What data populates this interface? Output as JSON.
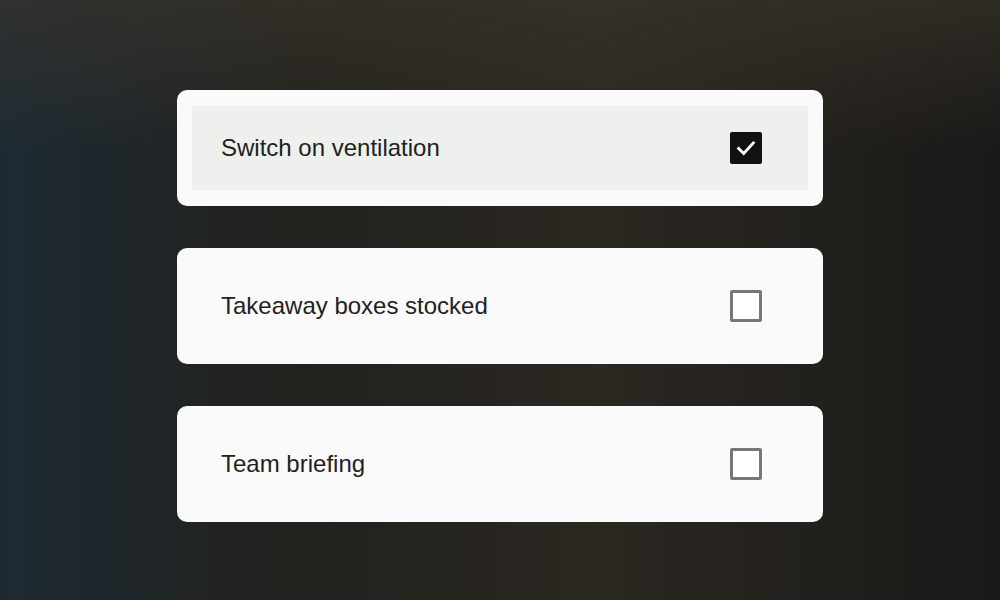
{
  "checklist": {
    "items": [
      {
        "label": "Switch on ventilation",
        "checked": true
      },
      {
        "label": "Takeaway boxes stocked",
        "checked": false
      },
      {
        "label": "Team briefing",
        "checked": false
      }
    ]
  }
}
